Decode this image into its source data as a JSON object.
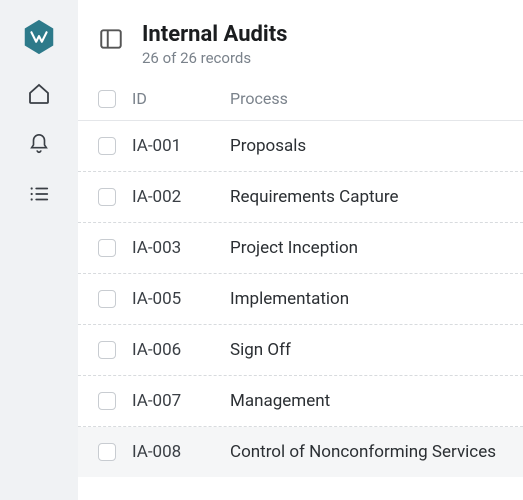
{
  "sidebar": {
    "items": [
      {
        "name": "logo-icon"
      },
      {
        "name": "home-icon"
      },
      {
        "name": "bell-icon"
      },
      {
        "name": "list-icon"
      }
    ]
  },
  "header": {
    "title": "Internal Audits",
    "subtitle": "26 of 26 records"
  },
  "columns": {
    "id": "ID",
    "process": "Process"
  },
  "rows": [
    {
      "id": "IA-001",
      "process": "Proposals"
    },
    {
      "id": "IA-002",
      "process": "Requirements Capture"
    },
    {
      "id": "IA-003",
      "process": "Project Inception"
    },
    {
      "id": "IA-005",
      "process": "Implementation"
    },
    {
      "id": "IA-006",
      "process": "Sign Off"
    },
    {
      "id": "IA-007",
      "process": "Management"
    },
    {
      "id": "IA-008",
      "process": "Control of Nonconforming Services",
      "highlight": true
    }
  ]
}
